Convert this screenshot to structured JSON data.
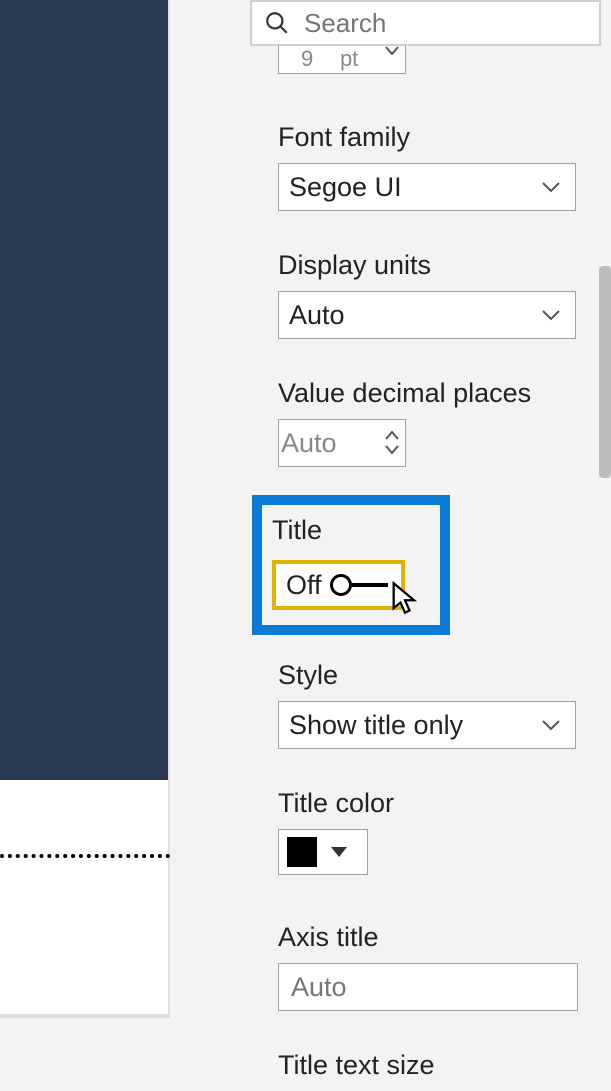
{
  "search": {
    "placeholder": "Search"
  },
  "partial_size": {
    "value": "9",
    "unit": "pt"
  },
  "font_family": {
    "label": "Font family",
    "value": "Segoe UI"
  },
  "display_units": {
    "label": "Display units",
    "value": "Auto"
  },
  "value_decimal": {
    "label": "Value decimal places",
    "value": "Auto"
  },
  "title_toggle": {
    "label": "Title",
    "state": "Off"
  },
  "style": {
    "label": "Style",
    "value": "Show title only"
  },
  "title_color": {
    "label": "Title color",
    "value": "#000000"
  },
  "axis_title": {
    "label": "Axis title",
    "value": "Auto"
  },
  "title_text_size": {
    "label": "Title text size"
  }
}
